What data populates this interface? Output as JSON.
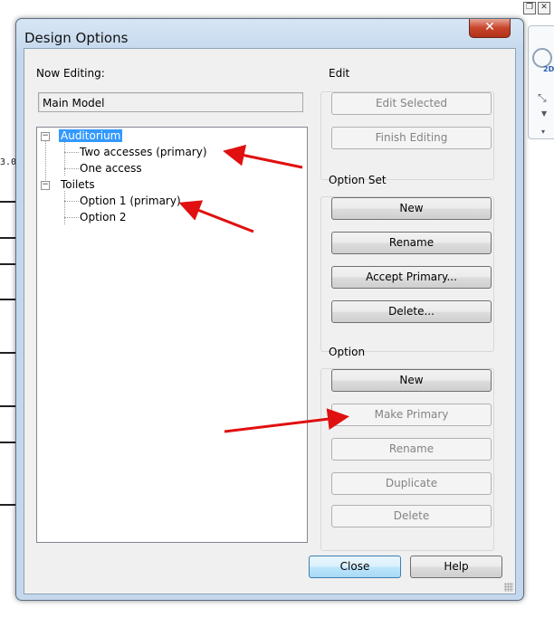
{
  "dialog": {
    "title": "Design Options",
    "close_glyph": "✕"
  },
  "now_editing": {
    "label": "Now Editing:",
    "value": "Main Model"
  },
  "tree": {
    "sets": [
      {
        "label": "Auditorium",
        "expanded": true,
        "selected": true,
        "options": [
          {
            "label": "Two accesses (primary)"
          },
          {
            "label": "One access"
          }
        ]
      },
      {
        "label": "Toilets",
        "expanded": true,
        "selected": false,
        "options": [
          {
            "label": "Option 1 (primary)"
          },
          {
            "label": "Option 2"
          }
        ]
      }
    ],
    "collapse_glyph": "−"
  },
  "edit_group": {
    "title": "Edit",
    "edit_selected": "Edit Selected",
    "finish_editing": "Finish Editing"
  },
  "option_set_group": {
    "title": "Option Set",
    "new": "New",
    "rename": "Rename",
    "accept_primary": "Accept Primary...",
    "delete": "Delete..."
  },
  "option_group": {
    "title": "Option",
    "new": "New",
    "make_primary": "Make Primary",
    "rename": "Rename",
    "duplicate": "Duplicate",
    "delete": "Delete"
  },
  "footer": {
    "close": "Close",
    "help": "Help"
  },
  "background": {
    "fragment_text": "3.00",
    "nav_label": "2D"
  },
  "colors": {
    "selection": "#3399ff",
    "annotation_arrow": "#e01010",
    "close_button_red": "#c7442a"
  }
}
